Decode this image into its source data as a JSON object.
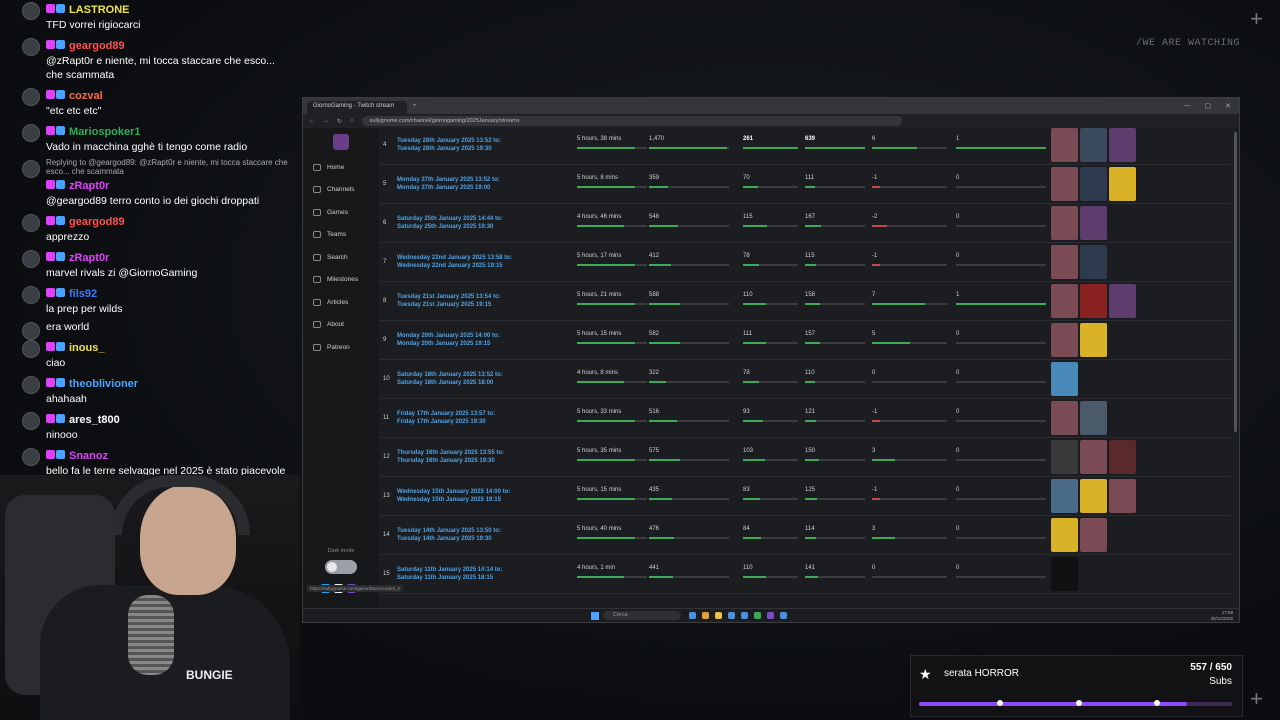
{
  "overlay": {
    "tagline": "/WE ARE WATCHING"
  },
  "chat": [
    {
      "user": "LASTRONE",
      "color": "#f0e34a",
      "text": "TFD vorrei rigiocarci"
    },
    {
      "user": "geargod89",
      "color": "#ff4f4f",
      "text": "@zRapt0r e niente, mi tocca staccare che esco... che scammata"
    },
    {
      "user": "cozval",
      "color": "#ff6b3d",
      "text": "\"etc etc etc\""
    },
    {
      "user": "Mariospoker1",
      "color": "#2eaf5b",
      "text": "Vado in macchina gghè ti tengo come radio"
    },
    {
      "user": "zRapt0r",
      "color": "#e040fb",
      "reply": "Replying to @geargod89: @zRapt0r e niente, mi tocca staccare che esco... che scammata",
      "text": "@geargod89 terro conto io dei giochi droppati"
    },
    {
      "user": "geargod89",
      "color": "#ff4f4f",
      "text": "apprezzo"
    },
    {
      "user": "zRapt0r",
      "color": "#e040fb",
      "text": "marvel rivals zi @GiornoGaming"
    },
    {
      "user": "fils92",
      "color": "#3d7bff",
      "text": "la prep per wilds"
    },
    {
      "user": "",
      "color": "#fff",
      "text": "era world"
    },
    {
      "user": "inous_",
      "color": "#f0e34a",
      "text": "ciao"
    },
    {
      "user": "theoblivioner",
      "color": "#4aa3ff",
      "text": "ahahaah"
    },
    {
      "user": "ares_t800",
      "color": "#ffffff",
      "text": "ninooo"
    },
    {
      "user": "Snanoz",
      "color": "#e040fb",
      "text": "bello fa le terre selvagge nel 2025 è stato piacevole"
    }
  ],
  "browser": {
    "tab_title": "GiornoGaming - Twitch stream",
    "url": "sullygnome.com/channel/giornogaming/2025January/streams",
    "status_url": "https://sullygnome.com/game/Dancecorket_2"
  },
  "sidebar": {
    "items": [
      {
        "label": "Home",
        "icon": "home-icon"
      },
      {
        "label": "Channels",
        "icon": "channels-icon"
      },
      {
        "label": "Games",
        "icon": "games-icon"
      },
      {
        "label": "Teams",
        "icon": "teams-icon"
      },
      {
        "label": "Search",
        "icon": "search-icon"
      },
      {
        "label": "Milestones",
        "icon": "milestones-icon"
      },
      {
        "label": "Articles",
        "icon": "articles-icon"
      },
      {
        "label": "About",
        "icon": "about-icon"
      },
      {
        "label": "Patreon",
        "icon": "patreon-icon"
      }
    ],
    "dark_mode_label": "Dark mode"
  },
  "streams": [
    {
      "n": "4",
      "d1": "Tuesday 28th January 2025 13:52 to:",
      "d2": "Tuesday 28th January 2025 19:30",
      "dur": "5 hours, 38 mins",
      "v": "1,470",
      "a": "261",
      "p": "639",
      "f": "6",
      "s": "1",
      "bold": true,
      "games": [
        "#7a4b55",
        "#3a4a5c",
        "#5c3d6e"
      ]
    },
    {
      "n": "5",
      "d1": "Monday 27th January 2025 13:52 to:",
      "d2": "Monday 27th January 2025 19:00",
      "dur": "5 hours, 8 mins",
      "v": "359",
      "a": "70",
      "p": "111",
      "f": "-1",
      "s": "0",
      "games": [
        "#7a4b55",
        "#2e3a4e",
        "#d9b227"
      ]
    },
    {
      "n": "6",
      "d1": "Saturday 25th January 2025 14:44 to:",
      "d2": "Saturday 25th January 2025 19:30",
      "dur": "4 hours, 46 mins",
      "v": "548",
      "a": "115",
      "p": "167",
      "f": "-2",
      "s": "0",
      "games": [
        "#7a4b55",
        "#5c3d6e"
      ]
    },
    {
      "n": "7",
      "d1": "Wednesday 22nd January 2025 13:58 to:",
      "d2": "Wednesday 22nd January 2025 19:15",
      "dur": "5 hours, 17 mins",
      "v": "412",
      "a": "78",
      "p": "115",
      "f": "-1",
      "s": "0",
      "games": [
        "#7a4b55",
        "#2e3a4e"
      ]
    },
    {
      "n": "8",
      "d1": "Tuesday 21st January 2025 13:54 to:",
      "d2": "Tuesday 21st January 2025 19:15",
      "dur": "5 hours, 21 mins",
      "v": "588",
      "a": "110",
      "p": "158",
      "f": "7",
      "s": "1",
      "games": [
        "#7a4b55",
        "#8a2222",
        "#5c3d6e"
      ]
    },
    {
      "n": "9",
      "d1": "Monday 20th January 2025 14:00 to:",
      "d2": "Monday 20th January 2025 19:15",
      "dur": "5 hours, 15 mins",
      "v": "582",
      "a": "111",
      "p": "157",
      "f": "5",
      "s": "0",
      "games": [
        "#7a4b55",
        "#d9b227"
      ]
    },
    {
      "n": "10",
      "d1": "Saturday 18th January 2025 13:52 to:",
      "d2": "Saturday 18th January 2025 18:00",
      "dur": "4 hours, 8 mins",
      "v": "322",
      "a": "78",
      "p": "110",
      "f": "0",
      "s": "0",
      "games": [
        "#4a8ab8"
      ]
    },
    {
      "n": "11",
      "d1": "Friday 17th January 2025 13:57 to:",
      "d2": "Friday 17th January 2025 19:30",
      "dur": "5 hours, 33 mins",
      "v": "516",
      "a": "93",
      "p": "121",
      "f": "-1",
      "s": "0",
      "games": [
        "#7a4b55",
        "#4a5a6a"
      ]
    },
    {
      "n": "12",
      "d1": "Thursday 16th January 2025 13:55 to:",
      "d2": "Thursday 16th January 2025 19:30",
      "dur": "5 hours, 35 mins",
      "v": "575",
      "a": "103",
      "p": "150",
      "f": "3",
      "s": "0",
      "games": [
        "#3a3a3a",
        "#7a4b55",
        "#5a2a2a"
      ]
    },
    {
      "n": "13",
      "d1": "Wednesday 15th January 2025 14:00 to:",
      "d2": "Wednesday 15th January 2025 19:15",
      "dur": "5 hours, 15 mins",
      "v": "435",
      "a": "83",
      "p": "125",
      "f": "-1",
      "s": "0",
      "games": [
        "#4a6a8a",
        "#d9b227",
        "#7a4b55"
      ]
    },
    {
      "n": "14",
      "d1": "Tuesday 14th January 2025 13:50 to:",
      "d2": "Tuesday 14th January 2025 19:30",
      "dur": "5 hours, 40 mins",
      "v": "476",
      "a": "84",
      "p": "114",
      "f": "3",
      "s": "0",
      "games": [
        "#d9b227",
        "#7a4b55"
      ]
    },
    {
      "n": "15",
      "d1": "Saturday 11th January 2025 14:14 to:",
      "d2": "Saturday 11th January 2025 18:15",
      "dur": "4 hours, 1 min",
      "v": "441",
      "a": "110",
      "p": "141",
      "f": "0",
      "s": "0",
      "games": [
        "#111111"
      ]
    }
  ],
  "taskbar": {
    "search_placeholder": "Cerca",
    "time": "17:58",
    "date": "30/12/2025"
  },
  "webcam": {
    "shirt_text": "BUNGIE"
  },
  "sub_goal": {
    "title": "serata HORROR",
    "current": 557,
    "target": 650,
    "count_text": "557 / 650",
    "unit": "Subs",
    "accent": "#9147ff"
  }
}
